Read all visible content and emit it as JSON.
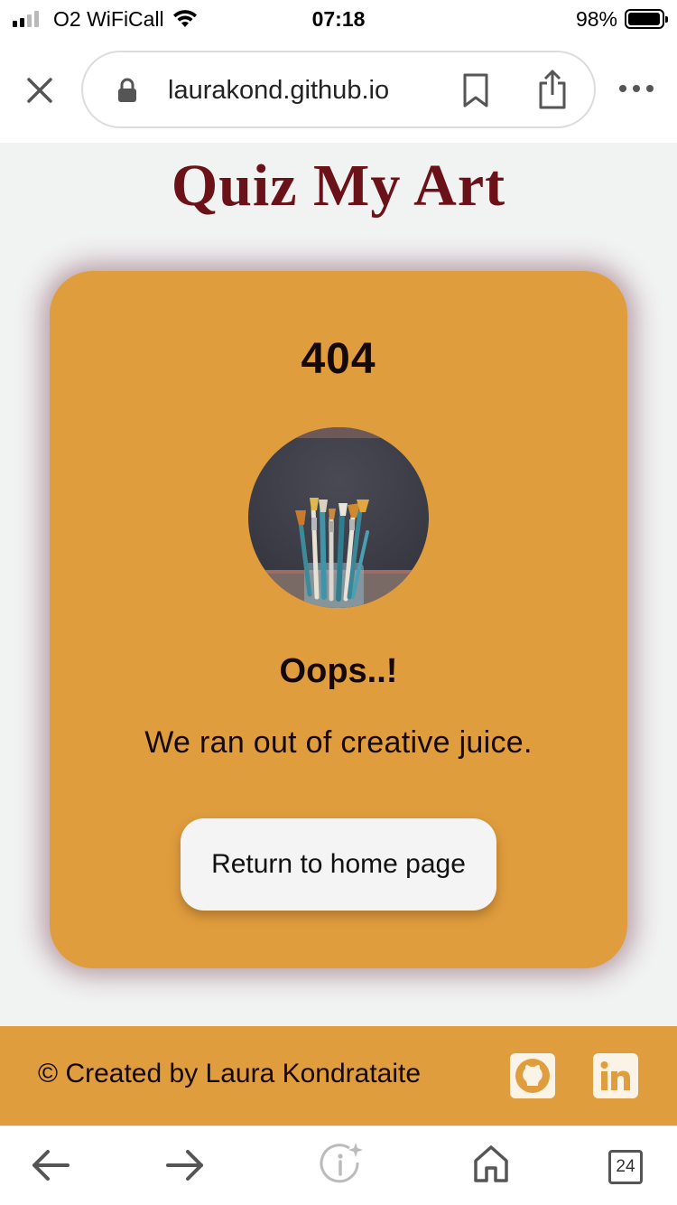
{
  "status_bar": {
    "carrier": "O2 WiFiCall",
    "time": "07:18",
    "battery_text": "98%",
    "battery_level": 0.98
  },
  "browser": {
    "url": "laurakond.github.io",
    "icons": [
      "close-icon",
      "lock-icon",
      "bookmark-icon",
      "share-icon",
      "more-icon"
    ]
  },
  "page": {
    "site_title": "Quiz My Art",
    "error_code": "404",
    "heading": "Oops..!",
    "message": "We ran out of creative juice.",
    "home_button": "Return to home page",
    "image_subject": "paint brushes in a jar"
  },
  "footer": {
    "credit": "© Created by Laura Kondrataite",
    "social_icons": [
      "github-icon",
      "linkedin-icon"
    ]
  },
  "toolbar": {
    "tabs_count": "24",
    "icons": [
      "back-arrow-icon",
      "forward-arrow-icon",
      "info-sparkle-icon",
      "home-icon",
      "tabs-icon"
    ]
  },
  "colors": {
    "brand_orange": "#e09d3d",
    "title_maroon": "#6b1218",
    "page_background": "#f1f2f2",
    "button_background": "#f4f4f4"
  }
}
